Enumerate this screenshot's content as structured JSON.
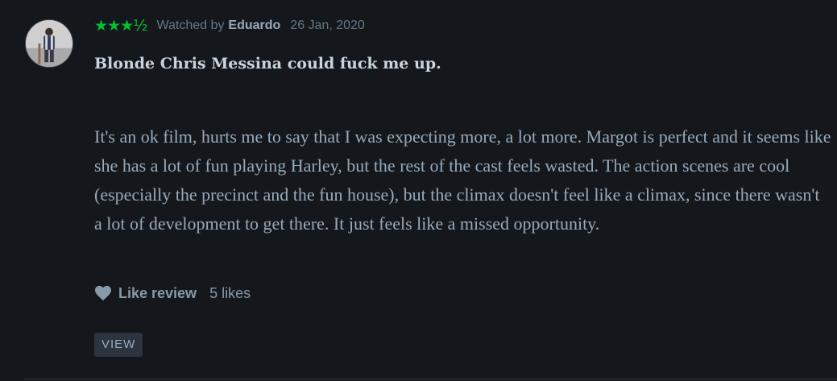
{
  "review": {
    "avatar_icon": "user-avatar-photo",
    "rating_stars": "★★★½",
    "rating_value": 3.5,
    "rating_color": "#00c030",
    "watched_by_prefix": "Watched by",
    "author": "Eduardo",
    "date": "26 Jan, 2020",
    "title": "Blonde Chris Messina could fuck me up.",
    "body": "It's an ok film, hurts me to say that I was expecting more, a lot more. Margot is perfect and it seems like she has a lot of fun playing Harley, but the rest of the cast feels wasted. The action scenes are cool (especially the precinct and the fun house), but the climax doesn't feel like a climax, since there wasn't a lot of development to get there. It just feels like a missed opportunity.",
    "like_icon": "heart-icon",
    "like_label": "Like review",
    "likes_count": "5 likes",
    "view_label": "VIEW"
  },
  "colors": {
    "background": "#14181c",
    "accent_green": "#00c030",
    "button_bg": "#2c3440"
  }
}
